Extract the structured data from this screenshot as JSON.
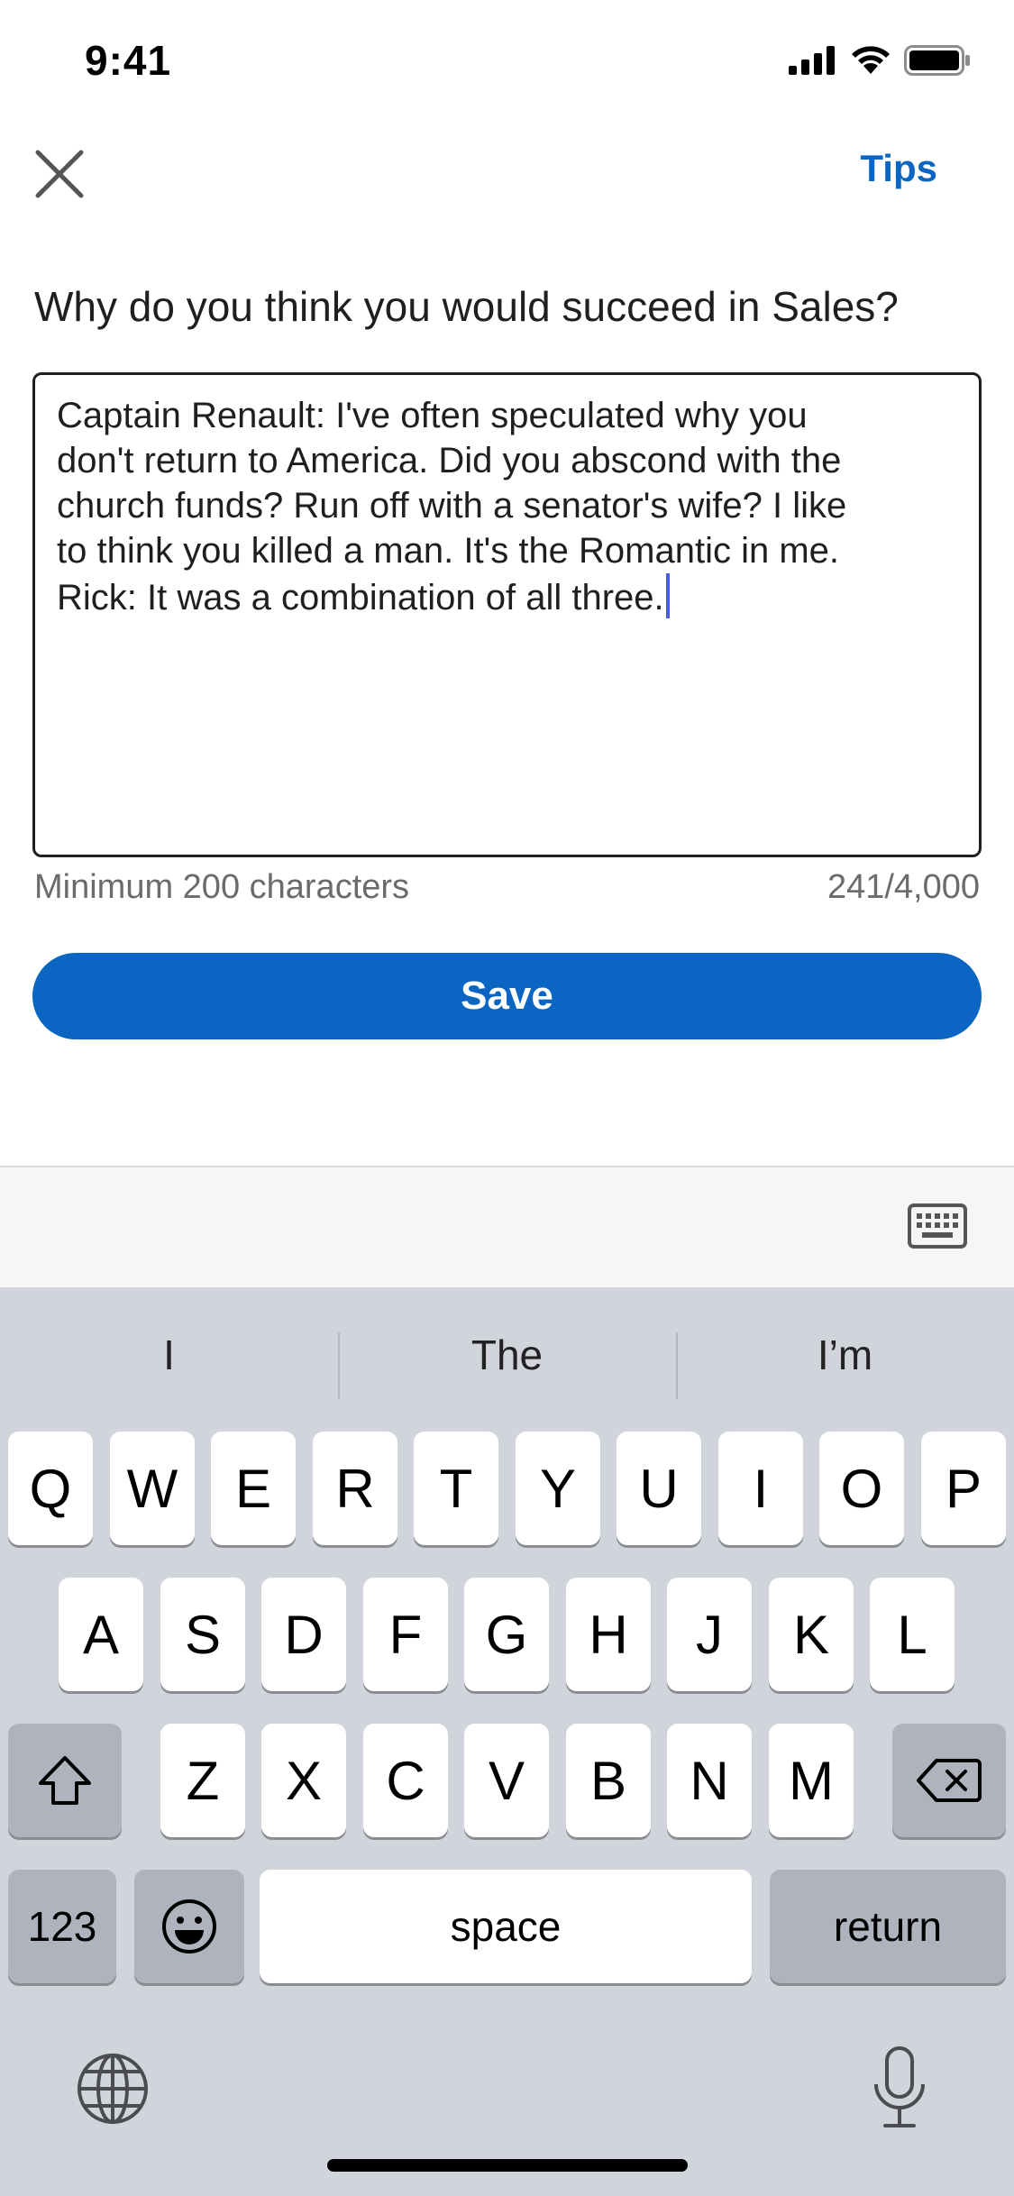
{
  "status_bar": {
    "time": "9:41"
  },
  "header": {
    "tips_label": "Tips"
  },
  "form": {
    "question": "Why do you think you would succeed in Sales?",
    "answer_text": "Captain Renault: I've often speculated why you\ndon't return to America. Did you abscond with the\nchurch funds? Run off with a senator's wife? I like\nto think you killed a man. It's the Romantic in me.\nRick: It was a combination of all three.",
    "helper_text": "Minimum 200 characters",
    "char_count": "241/4,000",
    "save_label": "Save"
  },
  "keyboard": {
    "suggestions": [
      "I",
      "The",
      "I’m"
    ],
    "row1": [
      "Q",
      "W",
      "E",
      "R",
      "T",
      "Y",
      "U",
      "I",
      "O",
      "P"
    ],
    "row2": [
      "A",
      "S",
      "D",
      "F",
      "G",
      "H",
      "J",
      "K",
      "L"
    ],
    "row3": [
      "Z",
      "X",
      "C",
      "V",
      "B",
      "N",
      "M"
    ],
    "numbers_label": "123",
    "space_label": "space",
    "return_label": "return"
  },
  "colors": {
    "accent": "#0a66c2",
    "keyboard_bg": "#d1d4db",
    "dark_key": "#aeb3bd"
  }
}
